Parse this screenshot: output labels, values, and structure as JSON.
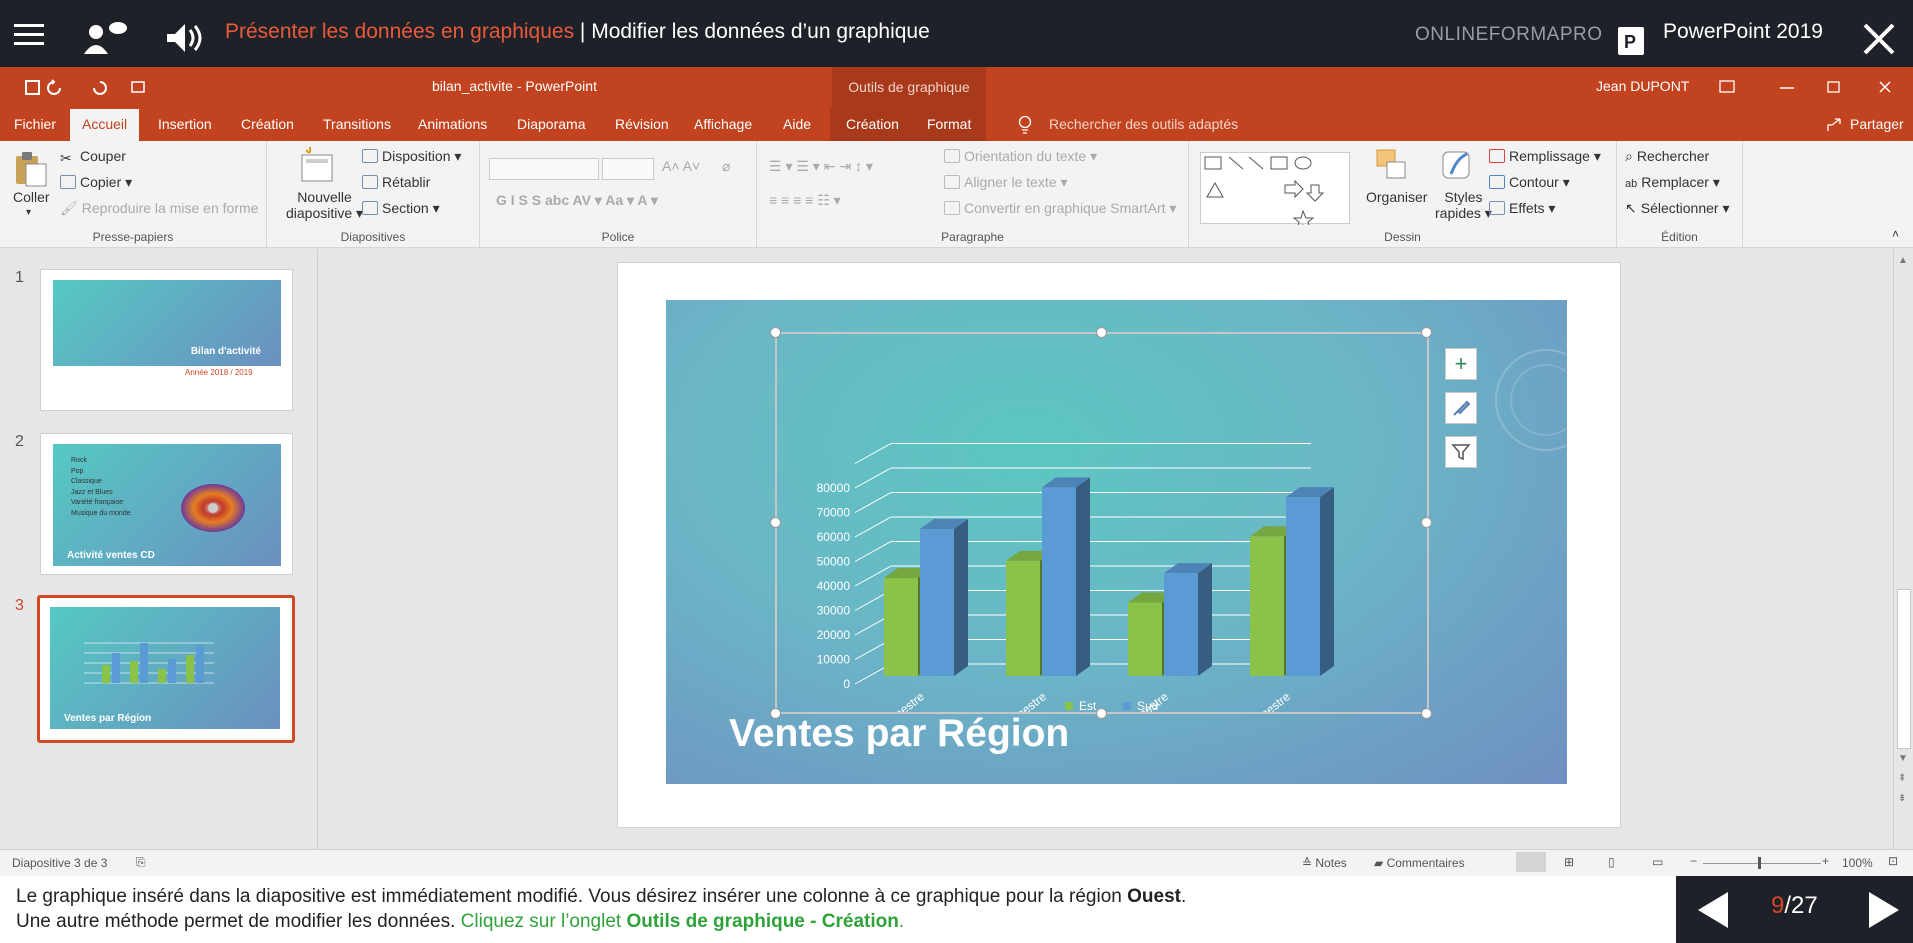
{
  "topbar": {
    "lesson_part1": "Présenter les données en graphiques",
    "separator": " | ",
    "lesson_part2": "Modifier les données d’un graphique",
    "brand": "ONLINEFORMAPRO",
    "product": "PowerPoint 2019"
  },
  "titlebar": {
    "document": "bilan_activite  -  PowerPoint",
    "context_tab": "Outils de graphique",
    "user": "Jean  DUPONT"
  },
  "tabs": {
    "fichier": "Fichier",
    "accueil": "Accueil",
    "insertion": "Insertion",
    "creation": "Création",
    "transitions": "Transitions",
    "animations": "Animations",
    "diaporama": "Diaporama",
    "revision": "Révision",
    "affichage": "Affichage",
    "aide": "Aide",
    "ctx_creation": "Création",
    "ctx_format": "Format",
    "search": "Rechercher des outils adaptés",
    "share": "Partager"
  },
  "ribbon": {
    "clipboard": {
      "paste": "Coller",
      "cut": "Couper",
      "copy": "Copier",
      "painter": "Reproduire la mise en forme",
      "label": "Presse-papiers"
    },
    "slides": {
      "new_line1": "Nouvelle",
      "new_line2": "diapositive",
      "layout": "Disposition",
      "reset": "Rétablir",
      "section": "Section",
      "label": "Diapositives"
    },
    "font": {
      "label": "Police"
    },
    "paragraph": {
      "orientation": "Orientation du texte",
      "align": "Aligner le texte",
      "smartart": "Convertir en graphique SmartArt",
      "label": "Paragraphe"
    },
    "drawing": {
      "arrange": "Organiser",
      "styles_line1": "Styles",
      "styles_line2": "rapides",
      "fill": "Remplissage",
      "outline": "Contour",
      "effects": "Effets",
      "label": "Dessin"
    },
    "editing": {
      "find": "Rechercher",
      "replace": "Remplacer",
      "select": "Sélectionner",
      "label": "Édition"
    }
  },
  "slides_panel": {
    "slides": [
      {
        "num": "1",
        "title": "Bilan d'activité",
        "subtitle": "Année 2018 / 2019"
      },
      {
        "num": "2",
        "title": "Activité ventes CD",
        "items": [
          "Rock",
          "Pop",
          "Classique",
          "Jazz et Blues",
          "Variété française",
          "Musique du monde"
        ]
      },
      {
        "num": "3",
        "title": "Ventes par Région"
      }
    ]
  },
  "slide": {
    "title": "Ventes par Région"
  },
  "chart_data": {
    "type": "bar",
    "categories": [
      "1er Trimestre",
      "2ème Trimestre",
      "3ème Trimestre",
      "4ème Trimestre"
    ],
    "series": [
      {
        "name": "Est",
        "values": [
          40000,
          47000,
          30000,
          57000
        ],
        "color": "#8bc34a"
      },
      {
        "name": "Sud",
        "values": [
          60000,
          77000,
          42000,
          73000
        ],
        "color": "#5b9bd5"
      }
    ],
    "yticks": [
      "0",
      "10000",
      "20000",
      "30000",
      "40000",
      "50000",
      "60000",
      "70000",
      "80000"
    ],
    "ylim": [
      0,
      80000
    ],
    "legend_position": "bottom",
    "grid": true
  },
  "statusbar": {
    "slide_info": "Diapositive 3 de 3",
    "notes": "Notes",
    "comments": "Commentaires",
    "zoom": "100%"
  },
  "instruction": {
    "line1_a": "Le graphique inséré dans la diapositive est immédiatement modifié. Vous désirez insérer une colonne à ce graphique pour la région ",
    "line1_b": "Ouest",
    "line1_c": ".",
    "line2_a": "Une autre méthode permet de modifier les données. ",
    "line2_b": "Cliquez sur l’onglet ",
    "line2_c": "Outils de graphique - Création",
    "line2_d": "."
  },
  "nav": {
    "current": "9",
    "total": "/27"
  }
}
